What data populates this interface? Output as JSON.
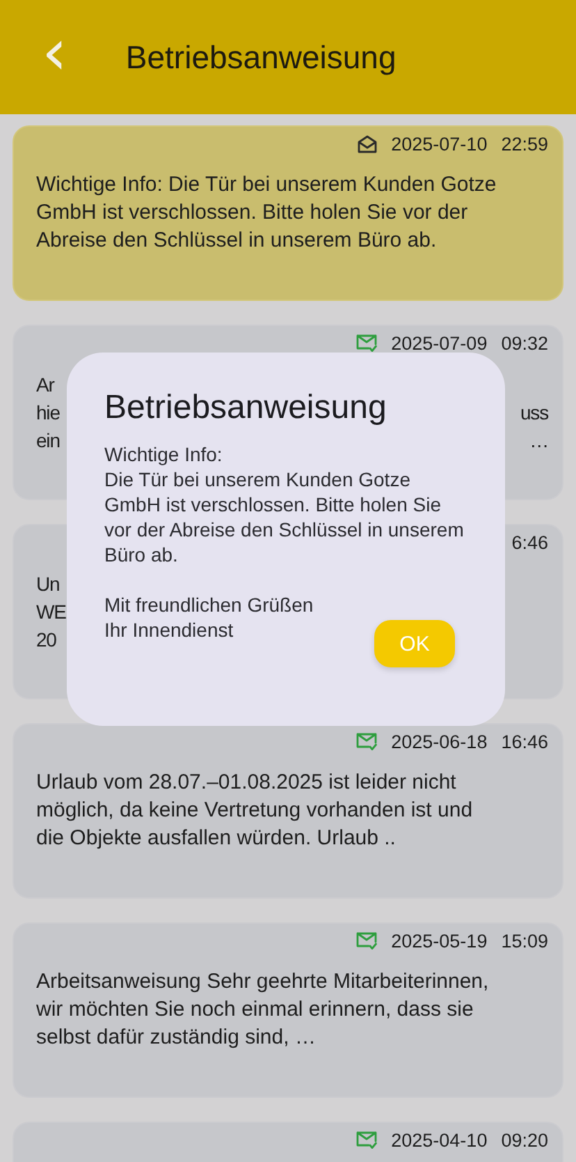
{
  "header": {
    "back": "‹",
    "title": "Betriebsanweisung"
  },
  "messages": [
    {
      "selected": true,
      "kind": "opened",
      "date": "2025-07-10",
      "time": "22:59",
      "lines": [
        {
          "start": "Wichtige Info: Die Tür bei unserem Kunden Gotze GmbH ist verschlossen. Bitte holen Sie vor der Abreise den Schlüssel in unserem Büro ab."
        }
      ]
    },
    {
      "selected": false,
      "kind": "confirmed",
      "date": "2025-07-09",
      "time": "09:32",
      "lines": [
        {
          "start": "Ar"
        },
        {
          "start": "hie",
          "end": "uss"
        },
        {
          "start": "ein",
          "end": "…"
        }
      ]
    },
    {
      "selected": false,
      "kind": "hidden",
      "time": "6:46",
      "lines": [
        {
          "start": "Un"
        },
        {
          "start": "WE"
        },
        {
          "start": "20"
        }
      ]
    },
    {
      "selected": false,
      "kind": "confirmed",
      "date": "2025-06-18",
      "time": "16:46",
      "lines": [
        {
          "start": "Urlaub vom 28.07.–01.08.2025 ist leider nicht möglich, da keine Vertretung vorhanden ist und die Objekte ausfallen würden. Urlaub .."
        }
      ]
    },
    {
      "selected": false,
      "kind": "confirmed",
      "date": "2025-05-19",
      "time": "15:09",
      "lines": [
        {
          "start": "Arbeitsanweisung Sehr geehrte Mitarbeiterinnen, wir möchten Sie noch einmal erinnern, dass sie selbst dafür zuständig sind, …"
        }
      ]
    },
    {
      "selected": false,
      "kind": "confirmed",
      "date": "2025-04-10",
      "time": "09:20"
    }
  ],
  "dialog": {
    "title": "Betriebsanweisung",
    "blocks": [
      [
        "Wichtige Info:",
        "Die Tür bei unserem Kunden Gotze GmbH ist verschlossen. Bitte holen Sie vor der Abreise den Schlüssel in unserem Büro ab."
      ],
      [
        "Mit freundlichen Grüßen",
        "Ihr Innendienst"
      ]
    ],
    "button": "OK"
  }
}
